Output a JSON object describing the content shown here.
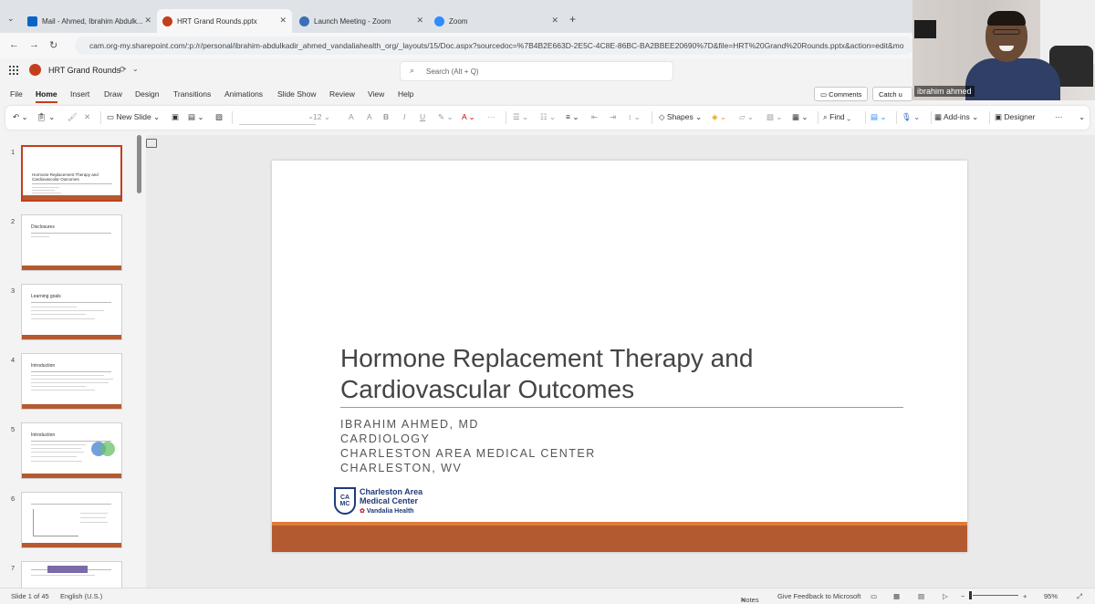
{
  "browser": {
    "tabs": [
      {
        "label": "Mail - Ahmed, Ibrahim Abdulk...",
        "color": "#0a64c8"
      },
      {
        "label": "HRT Grand Rounds.pptx",
        "color": "#c43e1c"
      },
      {
        "label": "Launch Meeting - Zoom",
        "color": "#3b6fb6"
      },
      {
        "label": "Zoom",
        "color": "#2d8cff"
      }
    ],
    "new_tab": "+",
    "url": "cam.org-my.sharepoint.com/:p:/r/personal/ibrahim-abdulkadir_ahmed_vandaliahealth_org/_layouts/15/Doc.aspx?sourcedoc=%7B4B2E663D-2E5C-4C8E-86BC-BA2BBEE20690%7D&file=HRT%20Grand%20Rounds.pptx&action=edit&mo"
  },
  "app": {
    "filename": "HRT Grand Rounds",
    "search_placeholder": "Search (Alt + Q)",
    "menus": [
      "File",
      "Home",
      "Insert",
      "Draw",
      "Design",
      "Transitions",
      "Animations",
      "Slide Show",
      "Review",
      "View",
      "Help"
    ],
    "comments_label": "Comments",
    "catchup_label": "Catch u"
  },
  "ribbon": {
    "new_slide": "New Slide",
    "font_size": "12",
    "shapes": "Shapes",
    "find": "Find",
    "addins": "Add-ins",
    "designer": "Designer"
  },
  "thumbnails": [
    {
      "num": "1",
      "title": "Hormone Replacement Therapy and Cardiovascular Outcomes"
    },
    {
      "num": "2",
      "title": "Disclosures"
    },
    {
      "num": "3",
      "title": "Learning goals"
    },
    {
      "num": "4",
      "title": "Introduction"
    },
    {
      "num": "5",
      "title": "Introduction"
    },
    {
      "num": "6",
      "title": ""
    },
    {
      "num": "7",
      "title": ""
    }
  ],
  "slide": {
    "title_line1": "Hormone Replacement Therapy and",
    "title_line2": "Cardiovascular Outcomes",
    "presenter": "IBRAHIM AHMED, MD",
    "department": "CARDIOLOGY",
    "institution": "CHARLESTON AREA MEDICAL CENTER",
    "location": "CHARLESTON, WV",
    "logo_line1": "Charleston Area",
    "logo_line2": "Medical Center",
    "logo_line3": "Vandalia Health",
    "logo_monogram": "CA MC"
  },
  "status": {
    "slide_count": "Slide 1 of 45",
    "language": "English (U.S.)",
    "notes": "Notes",
    "feedback": "Give Feedback to Microsoft",
    "zoom": "95%"
  },
  "video": {
    "participant": "ibrahim ahmed"
  }
}
